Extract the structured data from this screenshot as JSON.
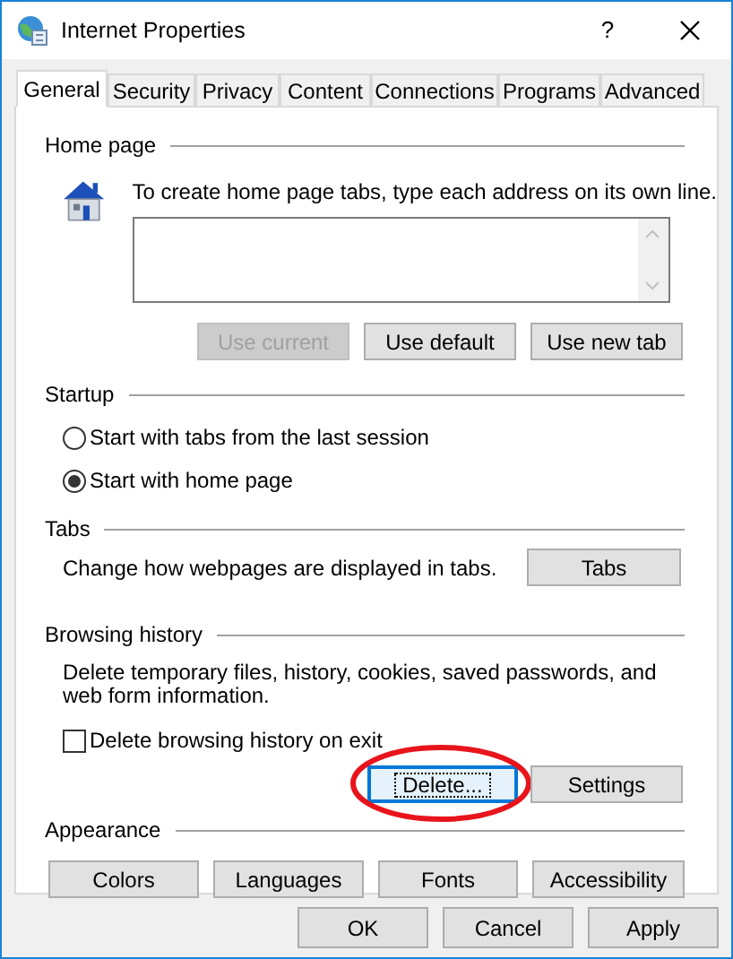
{
  "window": {
    "title": "Internet Properties",
    "help": "?"
  },
  "tabs": [
    {
      "label": "General",
      "selected": true
    },
    {
      "label": "Security",
      "selected": false
    },
    {
      "label": "Privacy",
      "selected": false
    },
    {
      "label": "Content",
      "selected": false
    },
    {
      "label": "Connections",
      "selected": false
    },
    {
      "label": "Programs",
      "selected": false
    },
    {
      "label": "Advanced",
      "selected": false
    }
  ],
  "home_page": {
    "heading": "Home page",
    "instruction": "To create home page tabs, type each address on its own line.",
    "buttons": [
      {
        "label": "Use current",
        "disabled": true
      },
      {
        "label": "Use default",
        "disabled": false
      },
      {
        "label": "Use new tab",
        "disabled": false
      }
    ]
  },
  "startup": {
    "heading": "Startup",
    "options": [
      {
        "label": "Start with tabs from the last session",
        "selected": false
      },
      {
        "label": "Start with home page",
        "selected": true
      }
    ]
  },
  "tabs_section": {
    "heading": "Tabs",
    "description": "Change how webpages are displayed in tabs.",
    "button": "Tabs"
  },
  "browsing_history": {
    "heading": "Browsing history",
    "description": "Delete temporary files, history, cookies, saved passwords, and web form information.",
    "checkbox": {
      "label": "Delete browsing history on exit",
      "checked": false
    },
    "buttons": [
      {
        "label": "Delete...",
        "focused": true,
        "circled": true
      },
      {
        "label": "Settings",
        "focused": false,
        "circled": false
      }
    ]
  },
  "appearance": {
    "heading": "Appearance",
    "buttons": [
      {
        "label": "Colors"
      },
      {
        "label": "Languages"
      },
      {
        "label": "Fonts"
      },
      {
        "label": "Accessibility"
      }
    ]
  },
  "footer_buttons": [
    {
      "label": "OK"
    },
    {
      "label": "Cancel"
    },
    {
      "label": "Apply"
    }
  ]
}
